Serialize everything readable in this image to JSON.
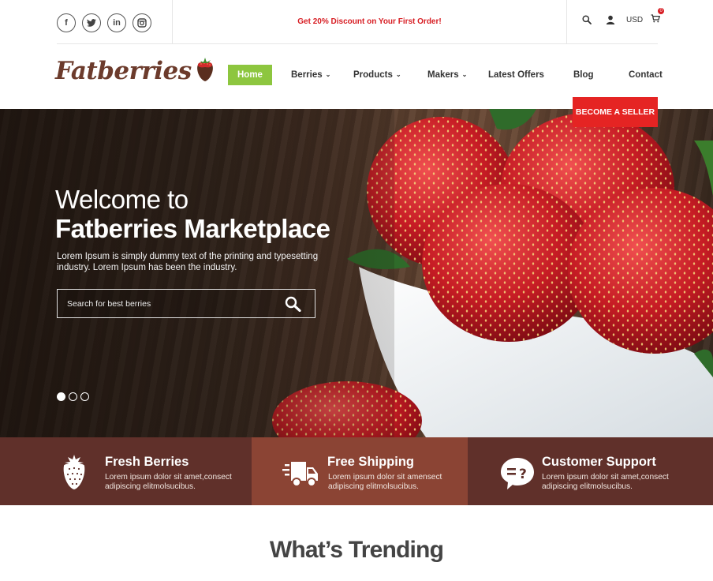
{
  "topbar": {
    "social": [
      {
        "name": "facebook",
        "glyph": "f"
      },
      {
        "name": "twitter",
        "glyph": "t"
      },
      {
        "name": "linkedin",
        "glyph": "in"
      },
      {
        "name": "instagram",
        "glyph": "◎"
      }
    ],
    "promo": "Get 20% Discount on Your First Order!",
    "currency": "USD",
    "cart_count": "0"
  },
  "brand": {
    "name": "Fatberries",
    "color": "#6c3b2c"
  },
  "nav": {
    "items": [
      {
        "label": "Home",
        "active": true,
        "dropdown": false
      },
      {
        "label": "Berries",
        "active": false,
        "dropdown": true
      },
      {
        "label": "Products",
        "active": false,
        "dropdown": true
      },
      {
        "label": "Makers",
        "active": false,
        "dropdown": true
      },
      {
        "label": "Latest Offers",
        "active": false,
        "dropdown": false
      },
      {
        "label": "Blog",
        "active": false,
        "dropdown": false
      },
      {
        "label": "Contact",
        "active": false,
        "dropdown": false
      }
    ],
    "seller_button": "BECOME A SELLER",
    "accent": "#8dc63f",
    "seller_color": "#e52423"
  },
  "hero": {
    "title_line1": "Welcome to",
    "title_line2": "Fatberries Marketplace",
    "description": "Lorem Ipsum is simply dummy text of the printing and typesetting industry. Lorem Ipsum has been the industry.",
    "search_placeholder": "Search for best berries",
    "slides": 3,
    "active_slide": 1
  },
  "features": [
    {
      "icon": "strawberry-icon",
      "title": "Fresh Berries",
      "description": "Lorem ipsum dolor sit amet,consect adipiscing elitmolsucibus.",
      "bg": "#60302a"
    },
    {
      "icon": "delivery-truck-icon",
      "title": "Free Shipping",
      "description": "Lorem ipsum dolor sit amensect adipiscing elitmolsucibus.",
      "bg": "#8b4434"
    },
    {
      "icon": "chat-question-icon",
      "title": "Customer Support",
      "description": "Lorem ipsum dolor sit amet,consect adipiscing elitmolsucibus.",
      "bg": "#60302a"
    }
  ],
  "trending": {
    "title": "What’s Trending"
  }
}
